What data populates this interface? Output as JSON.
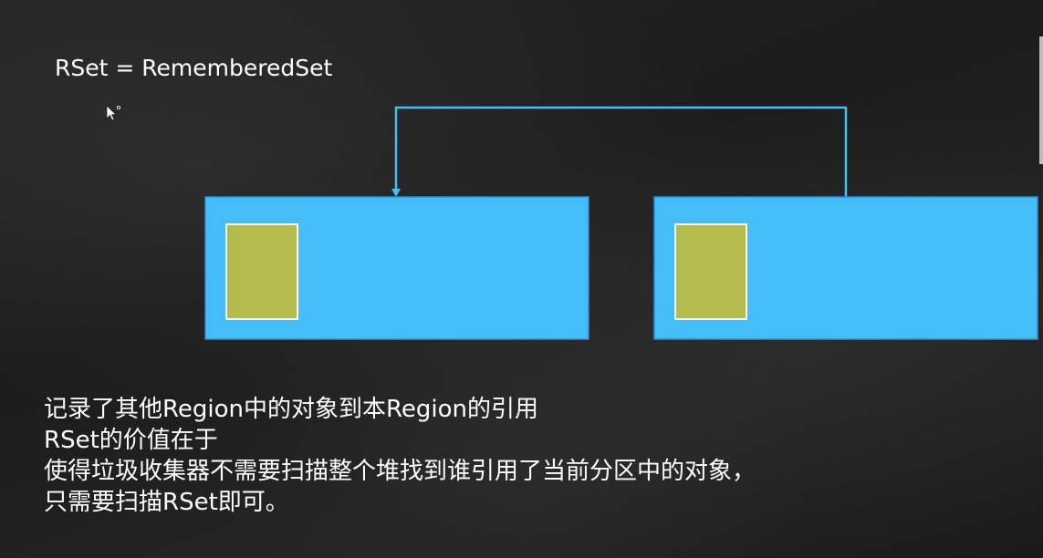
{
  "slide": {
    "title": "RSet = RememberedSet",
    "caption_lines": [
      "记录了其他Region中的对象到本Region的引用",
      "RSet的价值在于",
      "使得垃圾收集器不需要扫描整个堆找到谁引用了当前分区中的对象，",
      "只需要扫描RSet即可。"
    ]
  },
  "colors": {
    "region_fill": "#45bdf8",
    "region_border": "#2f8fd0",
    "rset_fill": "#b5bc4e",
    "rset_border": "#ffffff",
    "arrow": "#45bdf8"
  },
  "icons": {
    "cursor": "mouse-pointer-icon"
  }
}
